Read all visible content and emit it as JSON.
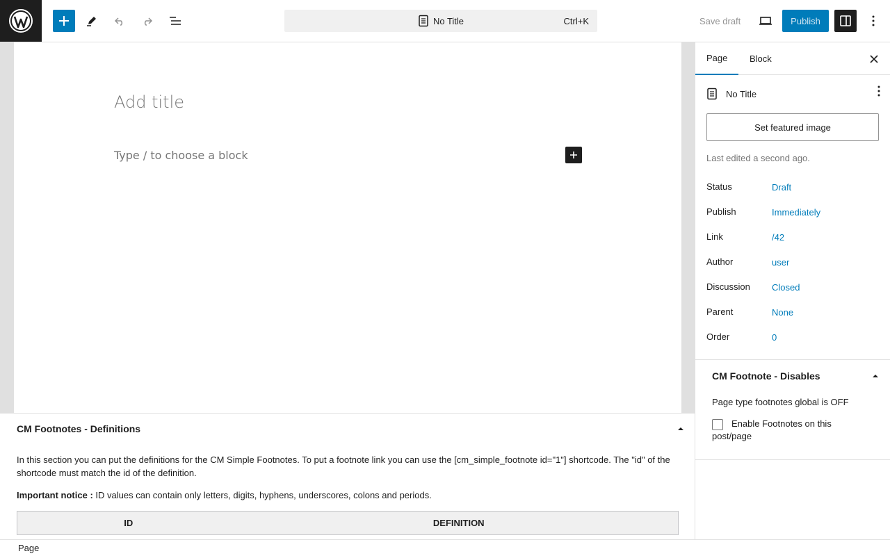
{
  "topbar": {
    "command_title": "No Title",
    "command_shortcut": "Ctrl+K",
    "save_draft": "Save draft",
    "publish": "Publish"
  },
  "editor": {
    "title_placeholder": "Add title",
    "block_placeholder": "Type / to choose a block"
  },
  "metabox": {
    "heading": "CM Footnotes - Definitions",
    "description": "In this section you can put the definitions for the CM Simple Footnotes. To put a footnote link you can use the [cm_simple_footnote id=\"1\"] shortcode. The \"id\" of the shortcode must match the id of the definition.",
    "notice_label": "Important notice :",
    "notice_text": " ID values can contain only letters, digits, hyphens, underscores, colons and periods.",
    "table_headers": [
      "ID",
      "DEFINITION"
    ]
  },
  "sidebar": {
    "tabs": [
      "Page",
      "Block"
    ],
    "post_title": "No Title",
    "featured_image_button": "Set featured image",
    "last_edited": "Last edited a second ago.",
    "rows": [
      {
        "label": "Status",
        "value": "Draft"
      },
      {
        "label": "Publish",
        "value": "Immediately"
      },
      {
        "label": "Link",
        "value": "/42"
      },
      {
        "label": "Author",
        "value": "user"
      },
      {
        "label": "Discussion",
        "value": "Closed"
      },
      {
        "label": "Parent",
        "value": "None"
      },
      {
        "label": "Order",
        "value": "0"
      }
    ],
    "cm_panel": {
      "heading": "CM Footnote - Disables",
      "global_status": "Page type footnotes global is OFF",
      "checkbox_label": "Enable Footnotes on this post/page",
      "checkbox_checked": false
    }
  },
  "footer": {
    "breadcrumb": "Page"
  },
  "colors": {
    "accent": "#007cba",
    "dark": "#1e1e1e"
  }
}
